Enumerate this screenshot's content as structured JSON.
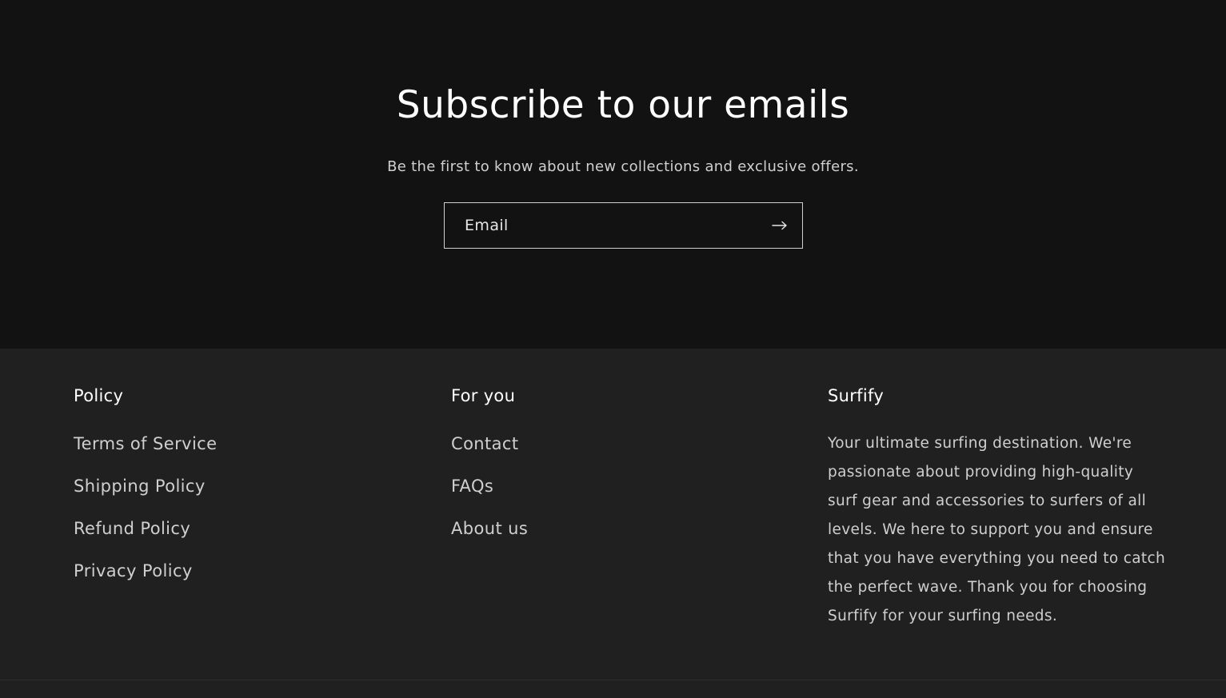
{
  "newsletter": {
    "title": "Subscribe to our emails",
    "subtitle": "Be the first to know about new collections and exclusive offers.",
    "email_placeholder": "Email",
    "submit_icon": "arrow-right-icon"
  },
  "footer": {
    "policy": {
      "heading": "Policy",
      "links": [
        "Terms of Service",
        "Shipping Policy",
        "Refund Policy",
        "Privacy Policy"
      ]
    },
    "for_you": {
      "heading": "For you",
      "links": [
        "Contact",
        "FAQs",
        "About us"
      ]
    },
    "brand": {
      "heading": "Surfify",
      "description": "Your ultimate surfing destination. We're passionate about providing high-quality surf gear and accessories to surfers of all levels. We here to support you and ensure that you have everything you need to catch the perfect wave. Thank you for choosing Surfify for your surfing needs."
    }
  },
  "colors": {
    "newsletter_bg": "#121212",
    "footer_bg": "#202020",
    "heading_text": "#ffffff",
    "body_text": "#cfcfcf"
  }
}
